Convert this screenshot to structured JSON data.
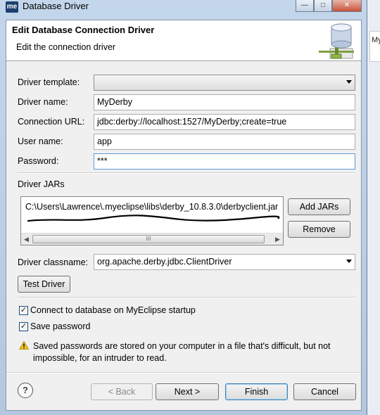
{
  "window": {
    "app_badge": "me",
    "title": "Database Driver",
    "minimize": "—",
    "maximize": "□",
    "close": "✕"
  },
  "background": {
    "side_tab_text": "My"
  },
  "banner": {
    "title": "Edit Database Connection Driver",
    "subtitle": "Edit the connection driver",
    "icon": "database-icon"
  },
  "form": {
    "driver_template": {
      "label": "Driver template:",
      "value": ""
    },
    "driver_name": {
      "label": "Driver name:",
      "value": "MyDerby"
    },
    "connection_url": {
      "label": "Connection URL:",
      "value": "jdbc:derby://localhost:1527/MyDerby;create=true"
    },
    "user_name": {
      "label": "User name:",
      "value": "app"
    },
    "password": {
      "label": "Password:",
      "value": "***"
    }
  },
  "jars": {
    "label": "Driver JARs",
    "items": [
      "C:\\Users\\Lawrence\\.myeclipse\\libs\\derby_10.8.3.0\\derbyclient.jar"
    ],
    "add_button": "Add JARs",
    "remove_button": "Remove",
    "scroll_left": "◀",
    "scroll_right": "▶",
    "scroll_grip": "III"
  },
  "classname": {
    "label": "Driver classname:",
    "value": "org.apache.derby.jdbc.ClientDriver"
  },
  "test_button": "Test Driver",
  "options": {
    "connect_on_startup": {
      "label": "Connect to database on MyEclipse startup",
      "checked": true
    },
    "save_password": {
      "label": "Save password",
      "checked": true
    },
    "check_mark": "✓"
  },
  "warning": {
    "icon": "warning-icon",
    "text": "Saved passwords are stored on your computer in a file that's difficult, but not impossible, for an intruder to read."
  },
  "footer": {
    "help": "?",
    "back": "< Back",
    "next": "Next >",
    "finish": "Finish",
    "cancel": "Cancel"
  },
  "colors": {
    "title_bar": "#c3d6eb",
    "dialog_bg": "#f0f0f0",
    "focus_border": "#5b9bd5",
    "default_button_border": "#3c7fb1"
  }
}
